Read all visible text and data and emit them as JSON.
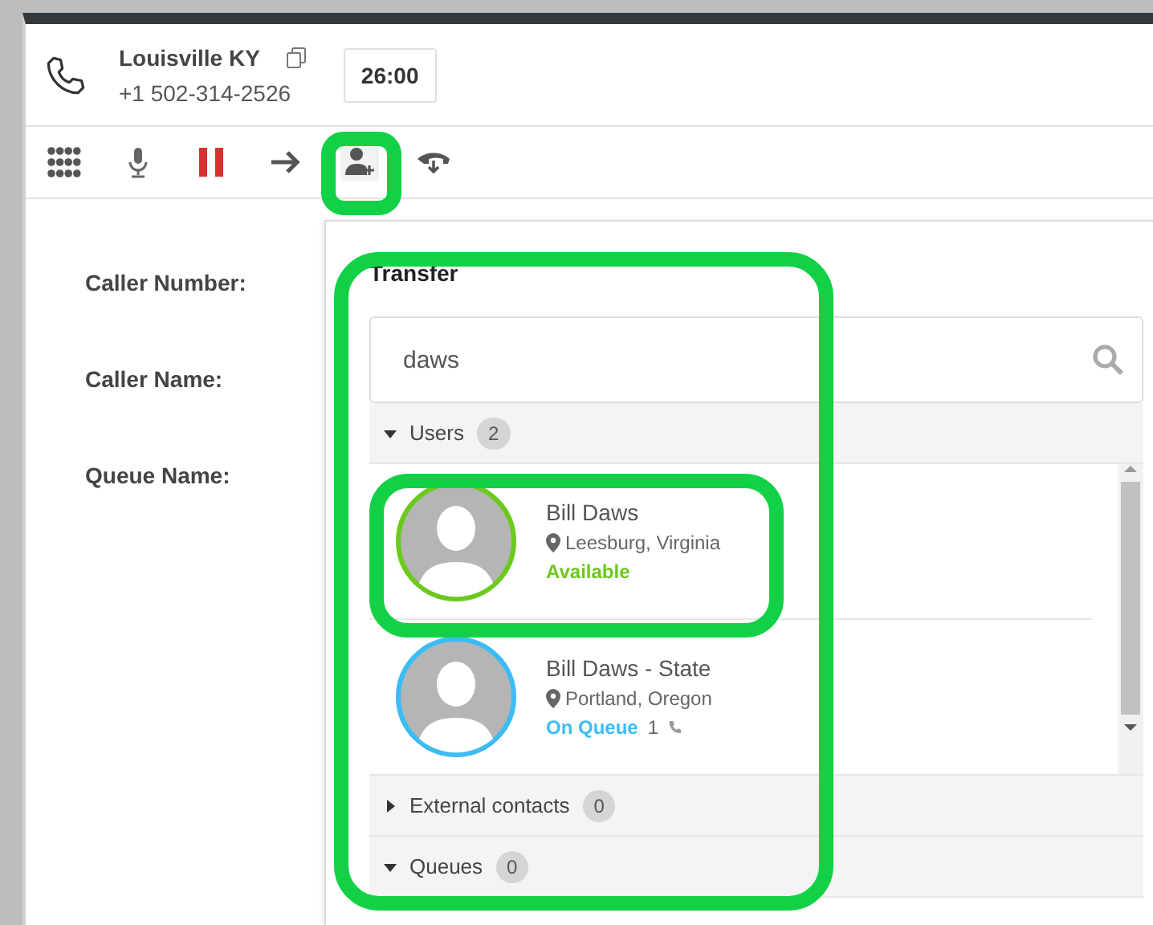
{
  "call": {
    "name": "Louisville KY",
    "number": "+1 502-314-2526",
    "timer": "26:00"
  },
  "toolbar": [
    {
      "kind": "dialpad",
      "selected": false
    },
    {
      "kind": "mute",
      "selected": false
    },
    {
      "kind": "hold",
      "selected": false
    },
    {
      "kind": "forward",
      "selected": false
    },
    {
      "kind": "transfer",
      "selected": true
    },
    {
      "kind": "hangup",
      "selected": false
    }
  ],
  "details": [
    "Caller Number:",
    "Caller Name:",
    "Queue Name:"
  ],
  "transfer": {
    "title": "Transfer",
    "search": {
      "value": "daws"
    },
    "sections": [
      {
        "label": "Users",
        "count": "2",
        "expanded": true,
        "items": [
          {
            "name": "Bill Daws",
            "location": "Leesburg, Virginia",
            "status": "Available",
            "color": "#6cc91e"
          },
          {
            "name": "Bill Daws - State",
            "location": "Portland, Oregon",
            "status": "On Queue",
            "color": "#3cbcf5",
            "calls": "1"
          }
        ]
      },
      {
        "label": "External contacts",
        "count": "0",
        "expanded": false
      },
      {
        "label": "Queues",
        "count": "0",
        "expanded": true
      }
    ]
  }
}
